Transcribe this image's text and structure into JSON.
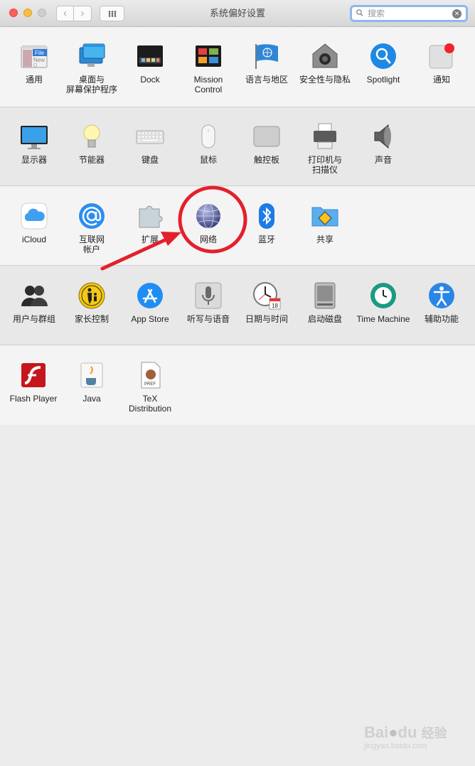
{
  "window": {
    "title": "系统偏好设置"
  },
  "nav": {
    "back": "‹",
    "forward": "›"
  },
  "search": {
    "placeholder": "搜索",
    "value": "",
    "clear": "✕"
  },
  "section1": {
    "items": [
      {
        "label": "通用",
        "icon": "general-icon"
      },
      {
        "label": "桌面与\n屏幕保护程序",
        "icon": "desktop-icon"
      },
      {
        "label": "Dock",
        "icon": "dock-icon"
      },
      {
        "label": "Mission\nControl",
        "icon": "mission-control-icon"
      },
      {
        "label": "语言与地区",
        "icon": "language-icon"
      },
      {
        "label": "安全性与隐私",
        "icon": "security-icon"
      },
      {
        "label": "Spotlight",
        "icon": "spotlight-icon"
      },
      {
        "label": "通知",
        "icon": "notifications-icon"
      }
    ]
  },
  "section2": {
    "items": [
      {
        "label": "显示器",
        "icon": "display-icon"
      },
      {
        "label": "节能器",
        "icon": "energy-icon"
      },
      {
        "label": "键盘",
        "icon": "keyboard-icon"
      },
      {
        "label": "鼠标",
        "icon": "mouse-icon"
      },
      {
        "label": "触控板",
        "icon": "trackpad-icon"
      },
      {
        "label": "打印机与\n扫描仪",
        "icon": "printer-icon"
      },
      {
        "label": "声音",
        "icon": "sound-icon"
      }
    ]
  },
  "section3": {
    "items": [
      {
        "label": "iCloud",
        "icon": "icloud-icon"
      },
      {
        "label": "互联网\n帐户",
        "icon": "internet-accounts-icon"
      },
      {
        "label": "扩展",
        "icon": "extensions-icon"
      },
      {
        "label": "网络",
        "icon": "network-icon"
      },
      {
        "label": "蓝牙",
        "icon": "bluetooth-icon"
      },
      {
        "label": "共享",
        "icon": "sharing-icon"
      }
    ]
  },
  "section4": {
    "items": [
      {
        "label": "用户与群组",
        "icon": "users-icon"
      },
      {
        "label": "家长控制",
        "icon": "parental-icon"
      },
      {
        "label": "App Store",
        "icon": "appstore-icon"
      },
      {
        "label": "听写与语音",
        "icon": "dictation-icon"
      },
      {
        "label": "日期与时间",
        "icon": "datetime-icon"
      },
      {
        "label": "启动磁盘",
        "icon": "startup-disk-icon"
      },
      {
        "label": "Time Machine",
        "icon": "time-machine-icon"
      },
      {
        "label": "辅助功能",
        "icon": "accessibility-icon"
      }
    ]
  },
  "section5": {
    "items": [
      {
        "label": "Flash Player",
        "icon": "flash-icon"
      },
      {
        "label": "Java",
        "icon": "java-icon"
      },
      {
        "label": "TeX\nDistribution",
        "icon": "tex-icon"
      }
    ]
  },
  "icon_text": {
    "general_file": "File",
    "general_new": "New",
    "general_o": "O",
    "tex_pref": "PREF",
    "calendar_day": "18"
  },
  "watermark": {
    "brand_a": "Bai",
    "brand_b": "du",
    "brand_cn": "经验",
    "url": "jingyan.baidu.com"
  },
  "colors": {
    "annotation_red": "#e4202b",
    "accent": "#1e7bd9"
  }
}
